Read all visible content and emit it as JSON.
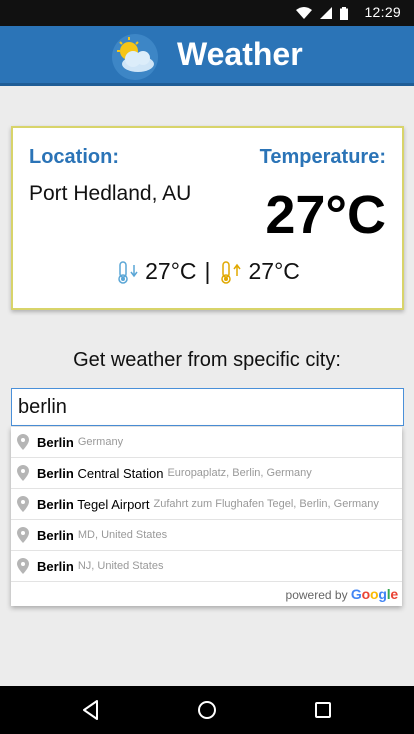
{
  "status_bar": {
    "time": "12:29",
    "icons": [
      "wifi-icon",
      "cellular-signal-icon",
      "battery-icon"
    ]
  },
  "app_bar": {
    "title": "Weather",
    "logo_icon": "sun-cloud-icon"
  },
  "weather_card": {
    "location_label": "Location:",
    "location_value": "Port Hedland, AU",
    "temperature_label": "Temperature:",
    "temperature_value": "27°C",
    "min_temp": "27°C",
    "separator": "|",
    "max_temp": "27°C"
  },
  "search": {
    "prompt": "Get weather from specific city:",
    "value": "berlin",
    "suggestions": [
      {
        "main_bold": "Berlin",
        "main_rest": "",
        "secondary": "Germany"
      },
      {
        "main_bold": "Berlin",
        "main_rest": " Central Station",
        "secondary": "Europaplatz, Berlin, Germany"
      },
      {
        "main_bold": "Berlin",
        "main_rest": " Tegel Airport",
        "secondary": "Zufahrt zum Flughafen Tegel, Berlin, Germany"
      },
      {
        "main_bold": "Berlin",
        "main_rest": "",
        "secondary": "MD, United States"
      },
      {
        "main_bold": "Berlin",
        "main_rest": "",
        "secondary": "NJ, United States"
      }
    ],
    "powered_by": "powered by",
    "google": "Google"
  },
  "colors": {
    "primary": "#2b74b7",
    "card_border": "#d8d46a",
    "input_border": "#4a90d9"
  },
  "nav_bar": {
    "buttons": [
      "back-icon",
      "home-icon",
      "recents-icon"
    ]
  }
}
